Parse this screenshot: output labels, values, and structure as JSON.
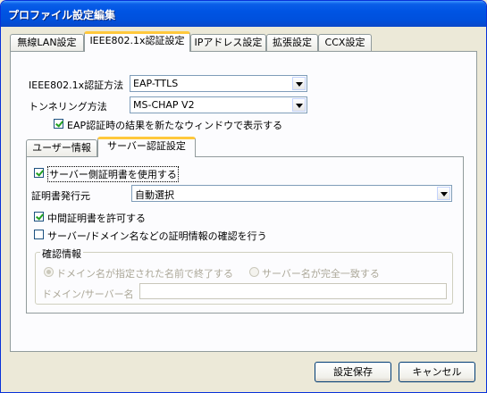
{
  "window": {
    "title": "プロファイル設定編集"
  },
  "tabs": [
    {
      "label": "無線LAN設定"
    },
    {
      "label": "IEEE802.1x認証設定"
    },
    {
      "label": "IPアドレス設定"
    },
    {
      "label": "拡張設定"
    },
    {
      "label": "CCX設定"
    }
  ],
  "auth": {
    "method_label": "IEEE802.1x認証方法",
    "method_value": "EAP-TTLS",
    "tunnel_label": "トンネリング方法",
    "tunnel_value": "MS-CHAP V2",
    "show_result_label": "EAP認証時の結果を新たなウィンドウで表示する",
    "show_result_checked": true
  },
  "subtabs": [
    {
      "label": "ユーザー情報"
    },
    {
      "label": "サーバー認証設定"
    }
  ],
  "server": {
    "use_server_cert_label": "サーバー側証明書を使用する",
    "use_server_cert_checked": true,
    "issuer_label": "証明書発行元",
    "issuer_value": "自動選択",
    "allow_intermediate_label": "中間証明書を許可する",
    "allow_intermediate_checked": true,
    "verify_label": "サーバー/ドメイン名などの証明情報の確認を行う",
    "verify_checked": false,
    "group_title": "確認情報",
    "radio_domain_label": "ドメイン名が指定された名前で終了する",
    "radio_exact_label": "サーバー名が完全一致する",
    "name_field_label": "ドメイン/サーバー名",
    "name_field_value": ""
  },
  "buttons": {
    "save": "設定保存",
    "cancel": "キャンセル"
  }
}
